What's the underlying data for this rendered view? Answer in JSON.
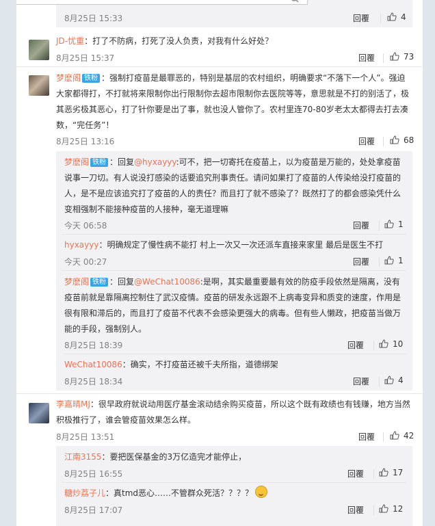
{
  "comments": [
    {
      "time": "8月25日 15:33",
      "reply": "回覆",
      "likes": "4"
    },
    {
      "user": "JD-忧重",
      "text": "：打了不防病，打死了没人负责，对我有什么好处？",
      "time": "8月25日 15:37",
      "reply": "回覆",
      "likes": "73"
    },
    {
      "user": "梦麽阁",
      "badge": "铁粉",
      "text": "：强制打疫苗是最罪恶的，特别是基层的农村组织，明确要求“不落下一个人”。强迫大家都得打，不打就将来限制你出行限制你去超市限制你去医院等等，意思就是不打的别活了，极其恶劣极其恶心，打了针你要是出了事，就也没人管你了。农村里连70-80岁老太太都得去打去凑数，“完任务”！",
      "time": "8月25日 13:16",
      "reply": "回覆",
      "likes": "68"
    },
    {
      "user": "梦麽阁",
      "badge": "铁粉",
      "prefix": "：回复",
      "mention": "@hyxayyy",
      "text": ":可不，把一切寄托在疫苗上，以为疫苗是万能的，处处拿疫苗说事一刀切。有人说没打感染的话要追究刑事责任。请问如果打了疫苗的人传染给没打疫苗的人，是不是应该追究打了疫苗的人的责任？而且打了就不感染了？既然打了的都会感染凭什么变相强制不能接种疫苗的人接种，毫无道理嘛",
      "time": "今天 06:58",
      "reply": "回覆",
      "likes": "1"
    },
    {
      "user": "hyxayyy",
      "text": "：明确规定了慢性病不能打 村上一次又一次还派车直接来家里 最后是医生不打",
      "time": "今天 00:27",
      "reply": "回覆",
      "likes": "1"
    },
    {
      "user": "梦麽阁",
      "badge": "铁粉",
      "prefix": "：回复",
      "mention": "@WeChat10086",
      "text": ":是啊，其实最重要最有效的防疫手段依然是隔离，没有疫苗前就是靠隔离控制住了武汉疫情。疫苗的研发永远跟不上病毒变异和质变的速度，作用是很有限和滞后的，而且打了疫苗不代表不会感染更强大的病毒。但有些人懒政，把疫苗当做万能的手段，强制别人。",
      "time": "8月25日 18:39",
      "reply": "回覆",
      "likes": "10"
    },
    {
      "user": "WeChat10086",
      "text": "：确实，不打疫苗还被千夫所指，道德绑架",
      "time": "8月25日 18:34",
      "reply": "回覆",
      "likes": "4"
    },
    {
      "user": "李嘉晴MJ",
      "text": "：很早政府就说动用医疗基金滚动结余购买疫苗，所以这个既有政绩也有钱赚，地方当然积极推行了，谁会管疫苗效果怎么样。",
      "time": "8月25日 13:51",
      "reply": "回覆",
      "likes": "42"
    },
    {
      "user": "江南3155",
      "text": "：要把医保基金的3万亿造完才能停止，",
      "time": "8月25日 16:55",
      "reply": "回覆",
      "likes": "17"
    },
    {
      "user": "糖炒荔子儿",
      "text": "：真tmd恶心……不管群众死活？？？？",
      "time": "8月25日 17:07",
      "reply": "回覆",
      "likes": "12"
    }
  ]
}
